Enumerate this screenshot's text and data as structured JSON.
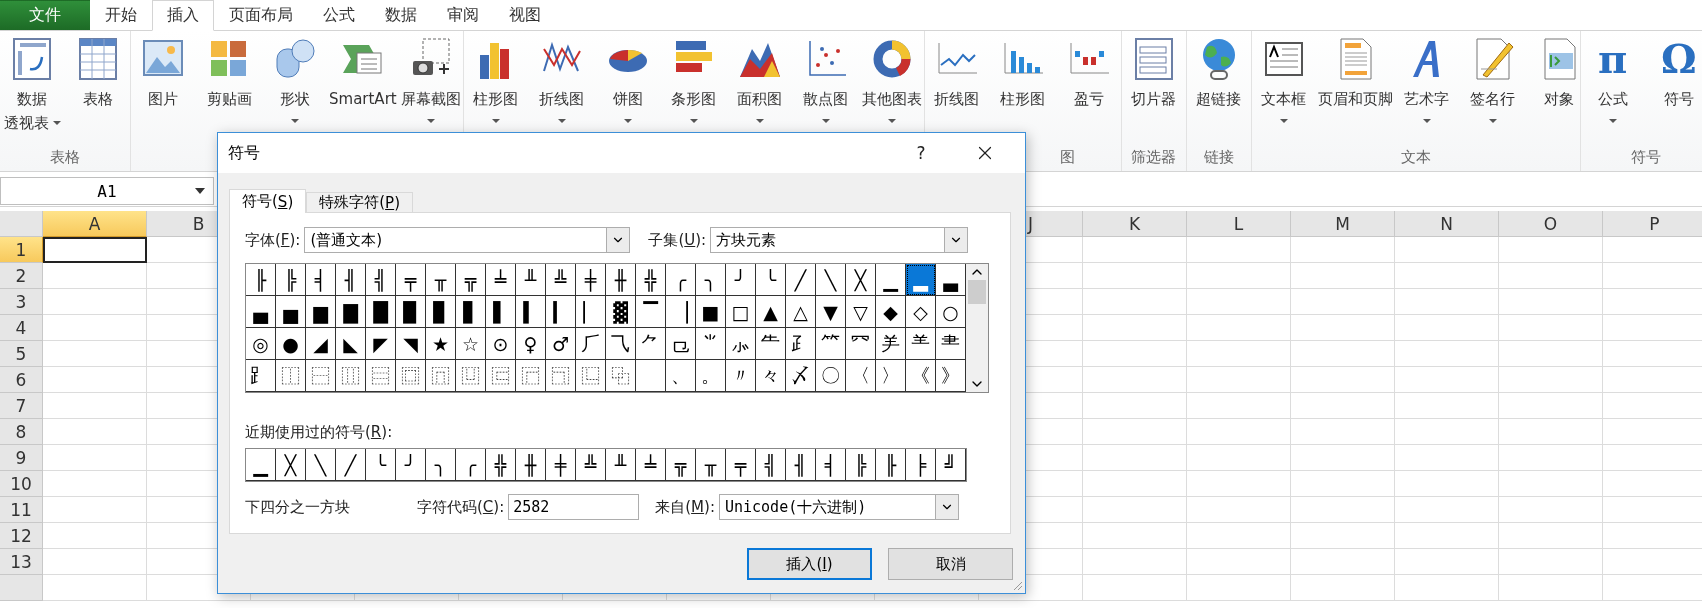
{
  "menu_tabs": [
    {
      "label": "文件",
      "kind": "file",
      "selected": false
    },
    {
      "label": "开始",
      "kind": "tab",
      "selected": false
    },
    {
      "label": "插入",
      "kind": "tab",
      "selected": true
    },
    {
      "label": "页面布局",
      "kind": "tab",
      "selected": false
    },
    {
      "label": "公式",
      "kind": "tab",
      "selected": false
    },
    {
      "label": "数据",
      "kind": "tab",
      "selected": false
    },
    {
      "label": "审阅",
      "kind": "tab",
      "selected": false
    },
    {
      "label": "视图",
      "kind": "tab",
      "selected": false
    }
  ],
  "ribbon": {
    "groups": [
      {
        "label": "表格",
        "buttons": [
          {
            "lines": [
              "数据",
              "透视表"
            ],
            "dropdown": true,
            "caret_inline": true
          },
          {
            "label": "表格"
          }
        ]
      },
      {
        "buttons": [
          {
            "label": "图片"
          },
          {
            "label": "剪贴画"
          },
          {
            "label": "形状",
            "dropdown": true
          },
          {
            "label": "SmartArt"
          },
          {
            "label": "屏幕截图",
            "dropdown": true
          }
        ]
      },
      {
        "buttons": [
          {
            "label": "柱形图",
            "dropdown": true
          },
          {
            "label": "折线图",
            "dropdown": true
          },
          {
            "label": "饼图",
            "dropdown": true
          },
          {
            "label": "条形图",
            "dropdown": true
          },
          {
            "label": "面积图",
            "dropdown": true
          },
          {
            "label": "散点图",
            "dropdown": true
          },
          {
            "label": "其他图表",
            "dropdown": true
          }
        ]
      },
      {
        "label": "图",
        "label_clipped": true,
        "buttons": [
          {
            "label": "折线图"
          },
          {
            "label": "柱形图"
          },
          {
            "label": "盈亏"
          }
        ]
      },
      {
        "label": "筛选器",
        "buttons": [
          {
            "label": "切片器"
          }
        ]
      },
      {
        "label": "链接",
        "buttons": [
          {
            "label": "超链接"
          }
        ]
      },
      {
        "label": "文本",
        "buttons": [
          {
            "label": "文本框",
            "dropdown": true
          },
          {
            "label": "页眉和页脚"
          },
          {
            "label": "艺术字",
            "dropdown": true
          },
          {
            "label": "签名行",
            "dropdown": true
          },
          {
            "label": "对象"
          }
        ]
      },
      {
        "label": "符号",
        "buttons": [
          {
            "label": "公式",
            "glyph": "π",
            "dropdown": true
          },
          {
            "label": "符号",
            "glyph": "Ω"
          }
        ]
      }
    ]
  },
  "name_box": "A1",
  "sheet": {
    "columns": [
      {
        "label": "A",
        "selected": true
      },
      {
        "label": "B",
        "selected": false
      },
      {},
      {},
      {},
      {},
      {},
      {},
      {},
      {
        "label": "J",
        "selected": false
      },
      {
        "label": "K",
        "selected": false
      },
      {
        "label": "L",
        "selected": false
      },
      {
        "label": "M",
        "selected": false
      },
      {
        "label": "N",
        "selected": false
      },
      {
        "label": "O",
        "selected": false
      },
      {
        "label": "P",
        "selected": false
      }
    ],
    "rows": [
      {
        "label": "1",
        "selected": true
      },
      {
        "label": "2",
        "selected": false
      },
      {
        "label": "3",
        "selected": false
      },
      {
        "label": "4",
        "selected": false
      },
      {
        "label": "5",
        "selected": false
      },
      {
        "label": "6",
        "selected": false
      },
      {
        "label": "7",
        "selected": false
      },
      {
        "label": "8",
        "selected": false
      },
      {
        "label": "9",
        "selected": false
      },
      {
        "label": "10",
        "selected": false
      },
      {
        "label": "11",
        "selected": false
      },
      {
        "label": "12",
        "selected": false
      },
      {
        "label": "13",
        "selected": false
      },
      {}
    ]
  },
  "dialog": {
    "title": "符号",
    "help": "?",
    "tabs": [
      {
        "label": {
          "before": "符号(",
          "key": "S",
          "after": ")"
        },
        "selected": true
      },
      {
        "label": {
          "before": "特殊字符(",
          "key": "P",
          "after": ")"
        },
        "selected": false
      }
    ],
    "font_label": {
      "before": "字体(",
      "key": "F",
      "after": "):"
    },
    "font_value": "(普通文本)",
    "subset_label": {
      "before": "子集(",
      "key": "U",
      "after": "):"
    },
    "subset_value": "方块元素",
    "grid": [
      [
        {
          "char": "╟",
          "selected": false
        },
        {
          "char": "╠",
          "selected": false
        },
        {
          "char": "╡",
          "selected": false
        },
        {
          "char": "╢",
          "selected": false
        },
        {
          "char": "╣",
          "selected": false
        },
        {
          "char": "╤",
          "selected": false
        },
        {
          "char": "╥",
          "selected": false
        },
        {
          "char": "╦",
          "selected": false
        },
        {
          "char": "╧",
          "selected": false
        },
        {
          "char": "╨",
          "selected": false
        },
        {
          "char": "╩",
          "selected": false
        },
        {
          "char": "╪",
          "selected": false
        },
        {
          "char": "╫",
          "selected": false
        },
        {
          "char": "╬",
          "selected": false
        },
        {
          "char": "╭",
          "selected": false
        },
        {
          "char": "╮",
          "selected": false
        },
        {
          "char": "╯",
          "selected": false
        },
        {
          "char": "╰",
          "selected": false
        },
        {
          "char": "╱",
          "selected": false
        },
        {
          "char": "╲",
          "selected": false
        },
        {
          "char": "╳",
          "selected": false
        },
        {
          "char": "▁",
          "selected": false
        },
        {
          "char": "▂",
          "selected": true
        },
        {
          "char": "▃",
          "selected": false
        }
      ],
      [
        {
          "char": "▄",
          "selected": false
        },
        {
          "char": "▅",
          "selected": false
        },
        {
          "char": "▆",
          "selected": false
        },
        {
          "char": "▇",
          "selected": false
        },
        {
          "char": "█",
          "selected": false
        },
        {
          "char": "▉",
          "selected": false
        },
        {
          "char": "▊",
          "selected": false
        },
        {
          "char": "▋",
          "selected": false
        },
        {
          "char": "▌",
          "selected": false
        },
        {
          "char": "▍",
          "selected": false
        },
        {
          "char": "▎",
          "selected": false
        },
        {
          "char": "▏",
          "selected": false
        },
        {
          "char": "▓",
          "selected": false
        },
        {
          "char": "▔",
          "selected": false
        },
        {
          "char": "▕",
          "selected": false
        },
        {
          "char": "■",
          "selected": false
        },
        {
          "char": "□",
          "selected": false
        },
        {
          "char": "▲",
          "selected": false
        },
        {
          "char": "△",
          "selected": false
        },
        {
          "char": "▼",
          "selected": false
        },
        {
          "char": "▽",
          "selected": false
        },
        {
          "char": "◆",
          "selected": false
        },
        {
          "char": "◇",
          "selected": false
        },
        {
          "char": "○",
          "selected": false
        }
      ],
      [
        {
          "char": "◎",
          "selected": false
        },
        {
          "char": "●",
          "selected": false
        },
        {
          "char": "◢",
          "selected": false
        },
        {
          "char": "◣",
          "selected": false
        },
        {
          "char": "◤",
          "selected": false
        },
        {
          "char": "◥",
          "selected": false
        },
        {
          "char": "★",
          "selected": false
        },
        {
          "char": "☆",
          "selected": false
        },
        {
          "char": "⊙",
          "selected": false
        },
        {
          "char": "♀",
          "selected": false
        },
        {
          "char": "♂",
          "selected": false
        },
        {
          "char": "⺁",
          "selected": false
        },
        {
          "char": "⺄",
          "selected": false
        },
        {
          "char": "⺈",
          "selected": false
        },
        {
          "char": "⺋",
          "selected": false
        },
        {
          "char": "⺌",
          "selected": false
        },
        {
          "char": "⺗",
          "selected": false
        },
        {
          "char": "⺧",
          "selected": false
        },
        {
          "char": "⺪",
          "selected": false
        },
        {
          "char": "⺮",
          "selected": false
        },
        {
          "char": "⺳",
          "selected": false
        },
        {
          "char": "⺶",
          "selected": false
        },
        {
          "char": "⺷",
          "selected": false
        },
        {
          "char": "⺻",
          "selected": false
        }
      ],
      [
        {
          "char": "⻊",
          "selected": false
        },
        {
          "char": "⿰",
          "selected": false
        },
        {
          "char": "⿱",
          "selected": false
        },
        {
          "char": "⿲",
          "selected": false
        },
        {
          "char": "⿳",
          "selected": false
        },
        {
          "char": "⿴",
          "selected": false
        },
        {
          "char": "⿵",
          "selected": false
        },
        {
          "char": "⿶",
          "selected": false
        },
        {
          "char": "⿷",
          "selected": false
        },
        {
          "char": "⿸",
          "selected": false
        },
        {
          "char": "⿹",
          "selected": false
        },
        {
          "char": "⿺",
          "selected": false
        },
        {
          "char": "⿻",
          "selected": false
        },
        {
          "selected": false
        },
        {
          "char": "、",
          "selected": false
        },
        {
          "char": "。",
          "selected": false
        },
        {
          "char": "〃",
          "selected": false
        },
        {
          "char": "々",
          "selected": false
        },
        {
          "char": "〆",
          "selected": false
        },
        {
          "char": "〇",
          "selected": false
        },
        {
          "char": "〈",
          "selected": false
        },
        {
          "char": "〉",
          "selected": false
        },
        {
          "char": "《",
          "selected": false
        },
        {
          "char": "》",
          "selected": false
        }
      ]
    ],
    "recent_label": {
      "before": "近期使用过的符号(",
      "key": "R",
      "after": "):"
    },
    "recent": [
      "▁",
      "╳",
      "╲",
      "╱",
      "╰",
      "╯",
      "╮",
      "╭",
      "╬",
      "╫",
      "╪",
      "╩",
      "╨",
      "╧",
      "╦",
      "╥",
      "╤",
      "╣",
      "╢",
      "╡",
      "╠",
      "╟",
      "╞",
      "╝"
    ],
    "description": "下四分之一方块",
    "code_label": {
      "before": "字符代码(",
      "key": "C",
      "after": "):"
    },
    "code_value": "2582",
    "from_label": {
      "before": "来自(",
      "key": "M",
      "after": "):"
    },
    "from_value": "Unicode(十六进制)",
    "buttons": [
      {
        "label": {
          "before": "插入(",
          "key": "I",
          "after": ")"
        },
        "default": true
      },
      {
        "label": {
          "before": "取消"
        },
        "default": false
      }
    ]
  }
}
